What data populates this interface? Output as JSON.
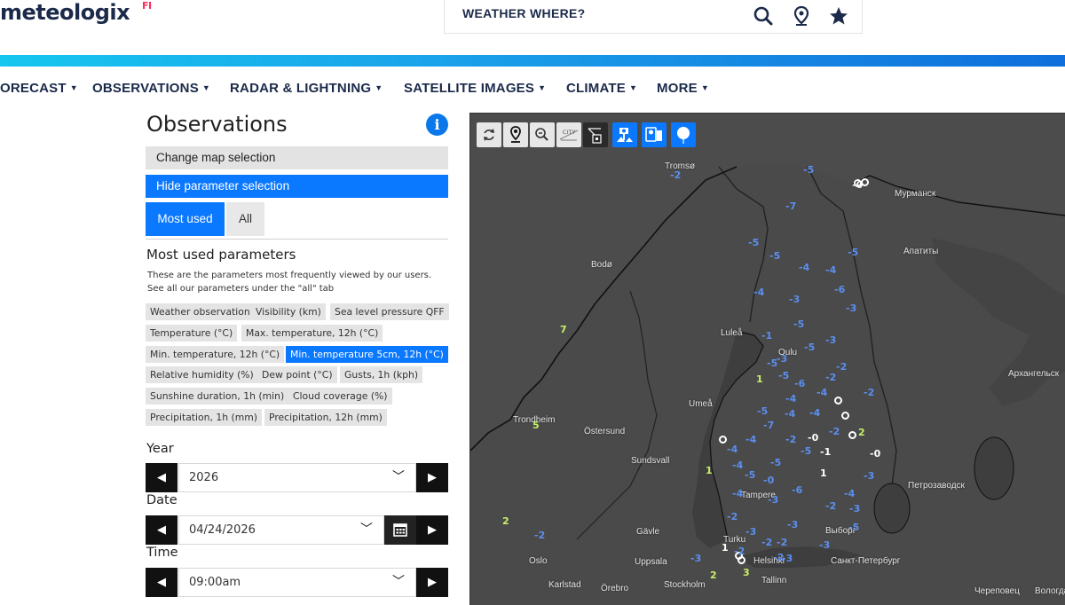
{
  "header": {
    "logo": "meteologix",
    "logo_country": "FI",
    "search_placeholder": "WEATHER WHERE?",
    "icons": [
      "search-icon",
      "location-pin-icon",
      "star-icon"
    ]
  },
  "nav": {
    "items": [
      {
        "label": "ORECAST"
      },
      {
        "label": "OBSERVATIONS"
      },
      {
        "label": "RADAR & LIGHTNING"
      },
      {
        "label": "SATELLITE IMAGES"
      },
      {
        "label": "CLIMATE"
      },
      {
        "label": "MORE"
      }
    ]
  },
  "panel": {
    "title": "Observations",
    "change_map": "Change map selection",
    "hide_params": "Hide parameter selection",
    "tabs": {
      "most_used": "Most used",
      "all": "All"
    },
    "section_title": "Most used parameters",
    "section_desc": "These are the parameters most frequently viewed by our users. See all our parameters under the \"all\" tab",
    "chips": [
      "Weather observation",
      "Visibility (km)",
      "Sea level pressure QFF",
      "Temperature (°C)",
      "Max. temperature, 12h (°C)",
      "Min. temperature, 12h (°C)",
      "Min. temperature 5cm, 12h (°C)",
      "Relative humidity (%)",
      "Dew point (°C)",
      "Gusts, 1h (kph)",
      "Sunshine duration, 1h (min)",
      "Cloud coverage (%)",
      "Precipitation, 1h (mm)",
      "Precipitation, 12h (mm)"
    ],
    "selected_chip": "Min. temperature 5cm, 12h (°C)",
    "year_label": "Year",
    "year_value": "2026",
    "date_label": "Date",
    "date_value": "04/24/2026",
    "time_label": "Time",
    "time_value": "09:00am"
  },
  "map": {
    "toolbar": [
      "refresh-icon",
      "location-pin-icon",
      "zoom-out-icon",
      "city-labels-icon",
      "station-plot-icon",
      "webcam-icon",
      "roadweather-icon",
      "balloon-icon"
    ],
    "city_toggle_label": "CITY",
    "cities": [
      "Tromsø",
      "Мурманск",
      "Bodø",
      "Апатиты",
      "Luleå",
      "Oulu",
      "Архангельск",
      "Umeå",
      "Trondheim",
      "Östersund",
      "Sundsvall",
      "Tampere",
      "Петрозаводск",
      "Gävle",
      "Turku",
      "Выборг",
      "Oslo",
      "Uppsala",
      "Helsinki",
      "Санкт-Петербург",
      "Karlstad",
      "Örebro",
      "Stockholm",
      "Tallinn",
      "Череповец",
      "Вологда"
    ],
    "observations": [
      "-5",
      "-2",
      "-0",
      "-7",
      "-5",
      "-5",
      "-4",
      "-4",
      "-5",
      "-4",
      "-6",
      "-3",
      "-3",
      "-5",
      "7",
      "-5",
      "-3",
      "-1",
      "-5",
      "-2",
      "-3",
      "1",
      "-5",
      "-2",
      "-6",
      "-4",
      "-4",
      "-2",
      "-5",
      "-7",
      "-4",
      "-4",
      "2",
      "5",
      "-4",
      "-2",
      "-0",
      "-5",
      "-2",
      "-1",
      "-0",
      "-4",
      "1",
      "-5",
      "-4",
      "-5",
      "-0",
      "1",
      "-3",
      "-6",
      "-4",
      "-3",
      "-4",
      "-2",
      "-3",
      "-2",
      "2",
      "-2",
      "-3",
      "-3",
      "-2",
      "1",
      "-2",
      "-3",
      "-3",
      "-2",
      "-3",
      "2",
      "3",
      "-2",
      "-5"
    ]
  }
}
